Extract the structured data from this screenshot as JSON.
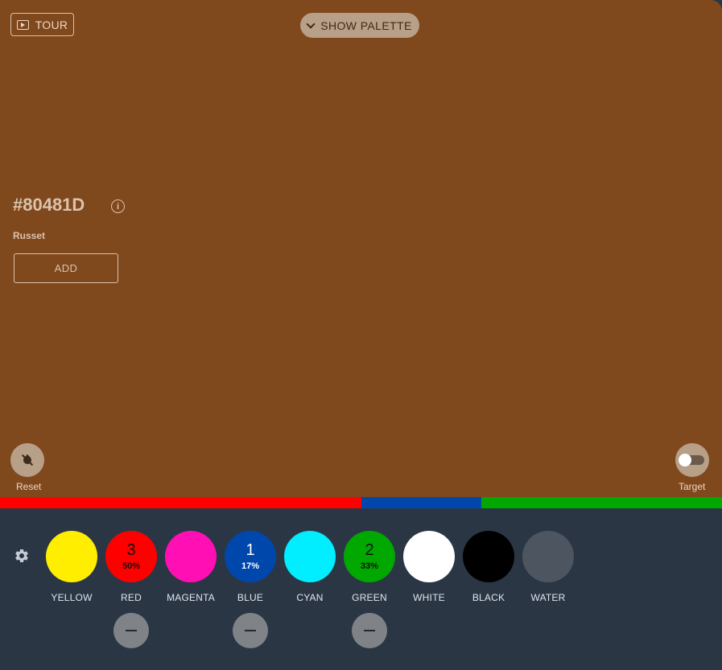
{
  "canvas": {
    "color": "#80481D"
  },
  "header": {
    "tour_label": "TOUR",
    "palette_label": "SHOW PALETTE"
  },
  "color_info": {
    "hex": "#80481D",
    "name": "Russet",
    "add_label": "ADD"
  },
  "controls": {
    "reset_label": "Reset",
    "target_label": "Target",
    "target_enabled": false
  },
  "mix_bar": [
    {
      "paint": "RED",
      "color": "#ff0000",
      "fraction": 0.5
    },
    {
      "paint": "BLUE",
      "color": "#0047ab",
      "fraction": 0.1667
    },
    {
      "paint": "GREEN",
      "color": "#00a800",
      "fraction": 0.3333
    }
  ],
  "paints": [
    {
      "label": "YELLOW",
      "color": "#ffee00",
      "count": "",
      "percent": ""
    },
    {
      "label": "RED",
      "color": "#ff0000",
      "count": "3",
      "percent": "50%"
    },
    {
      "label": "MAGENTA",
      "color": "#ff0fb4",
      "count": "",
      "percent": ""
    },
    {
      "label": "BLUE",
      "color": "#0047ab",
      "count": "1",
      "percent": "17%"
    },
    {
      "label": "CYAN",
      "color": "#00eeff",
      "count": "",
      "percent": ""
    },
    {
      "label": "GREEN",
      "color": "#00a800",
      "count": "2",
      "percent": "33%"
    },
    {
      "label": "WHITE",
      "color": "#ffffff",
      "count": "",
      "percent": ""
    },
    {
      "label": "BLACK",
      "color": "#000000",
      "count": "",
      "percent": ""
    },
    {
      "label": "WATER",
      "color": "#4d5560",
      "count": "",
      "percent": ""
    }
  ],
  "icons": {
    "tour": "tour-play-icon",
    "palette": "chevron-down-icon",
    "info": "info-icon",
    "reset": "no-drop-icon",
    "settings": "gear-icon",
    "remove": "minus-icon"
  }
}
